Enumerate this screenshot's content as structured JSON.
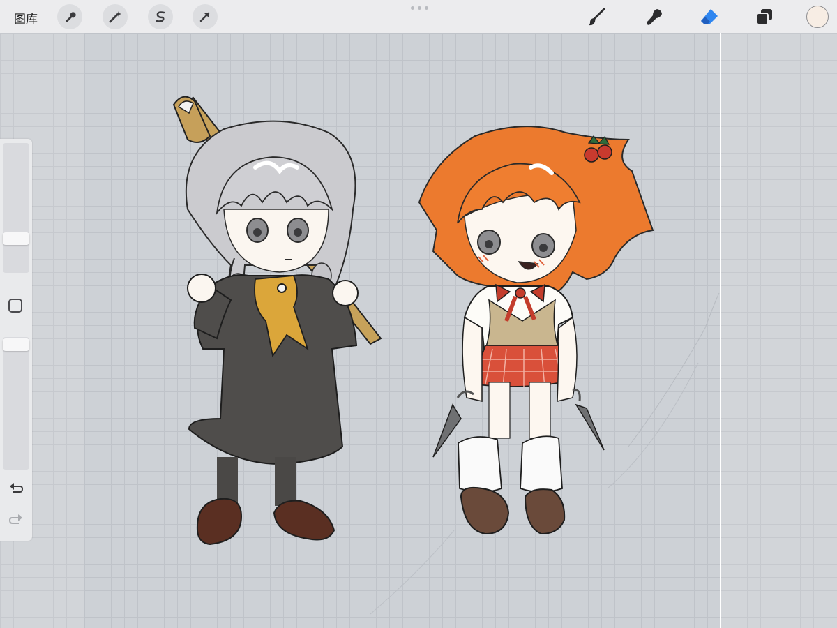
{
  "toolbar": {
    "gallery_label": "图库",
    "left_tools": [
      {
        "name": "actions",
        "icon": "wrench-icon"
      },
      {
        "name": "adjustments",
        "icon": "magic-wand-icon"
      },
      {
        "name": "selection",
        "icon": "selection-s-icon"
      },
      {
        "name": "transform",
        "icon": "arrow-cursor-icon"
      }
    ],
    "right_tools": [
      {
        "name": "brush",
        "icon": "brush-icon"
      },
      {
        "name": "smudge",
        "icon": "smudge-icon"
      },
      {
        "name": "eraser",
        "icon": "eraser-icon",
        "active": true
      },
      {
        "name": "layers",
        "icon": "layers-icon"
      }
    ],
    "active_tool_color": "#2f86f0",
    "current_color": "#f7ede4"
  },
  "sidebar": {
    "brush_size_slider": {
      "level": 0.23
    },
    "opacity_slider": {
      "level": 0.0
    },
    "buttons": [
      "modify-square",
      "undo-icon",
      "redo-icon"
    ]
  },
  "canvas": {
    "background": "#cdd1d6",
    "artwork": [
      {
        "name": "gray-haired-girl",
        "hair": "#c8c8cc",
        "uniform": "#4a4846",
        "scarf": "#d9a83a"
      },
      {
        "name": "orange-haired-girl",
        "hair": "#ec7a2e",
        "skirt": "#d9503a",
        "vest": "#c9b68f"
      }
    ]
  }
}
